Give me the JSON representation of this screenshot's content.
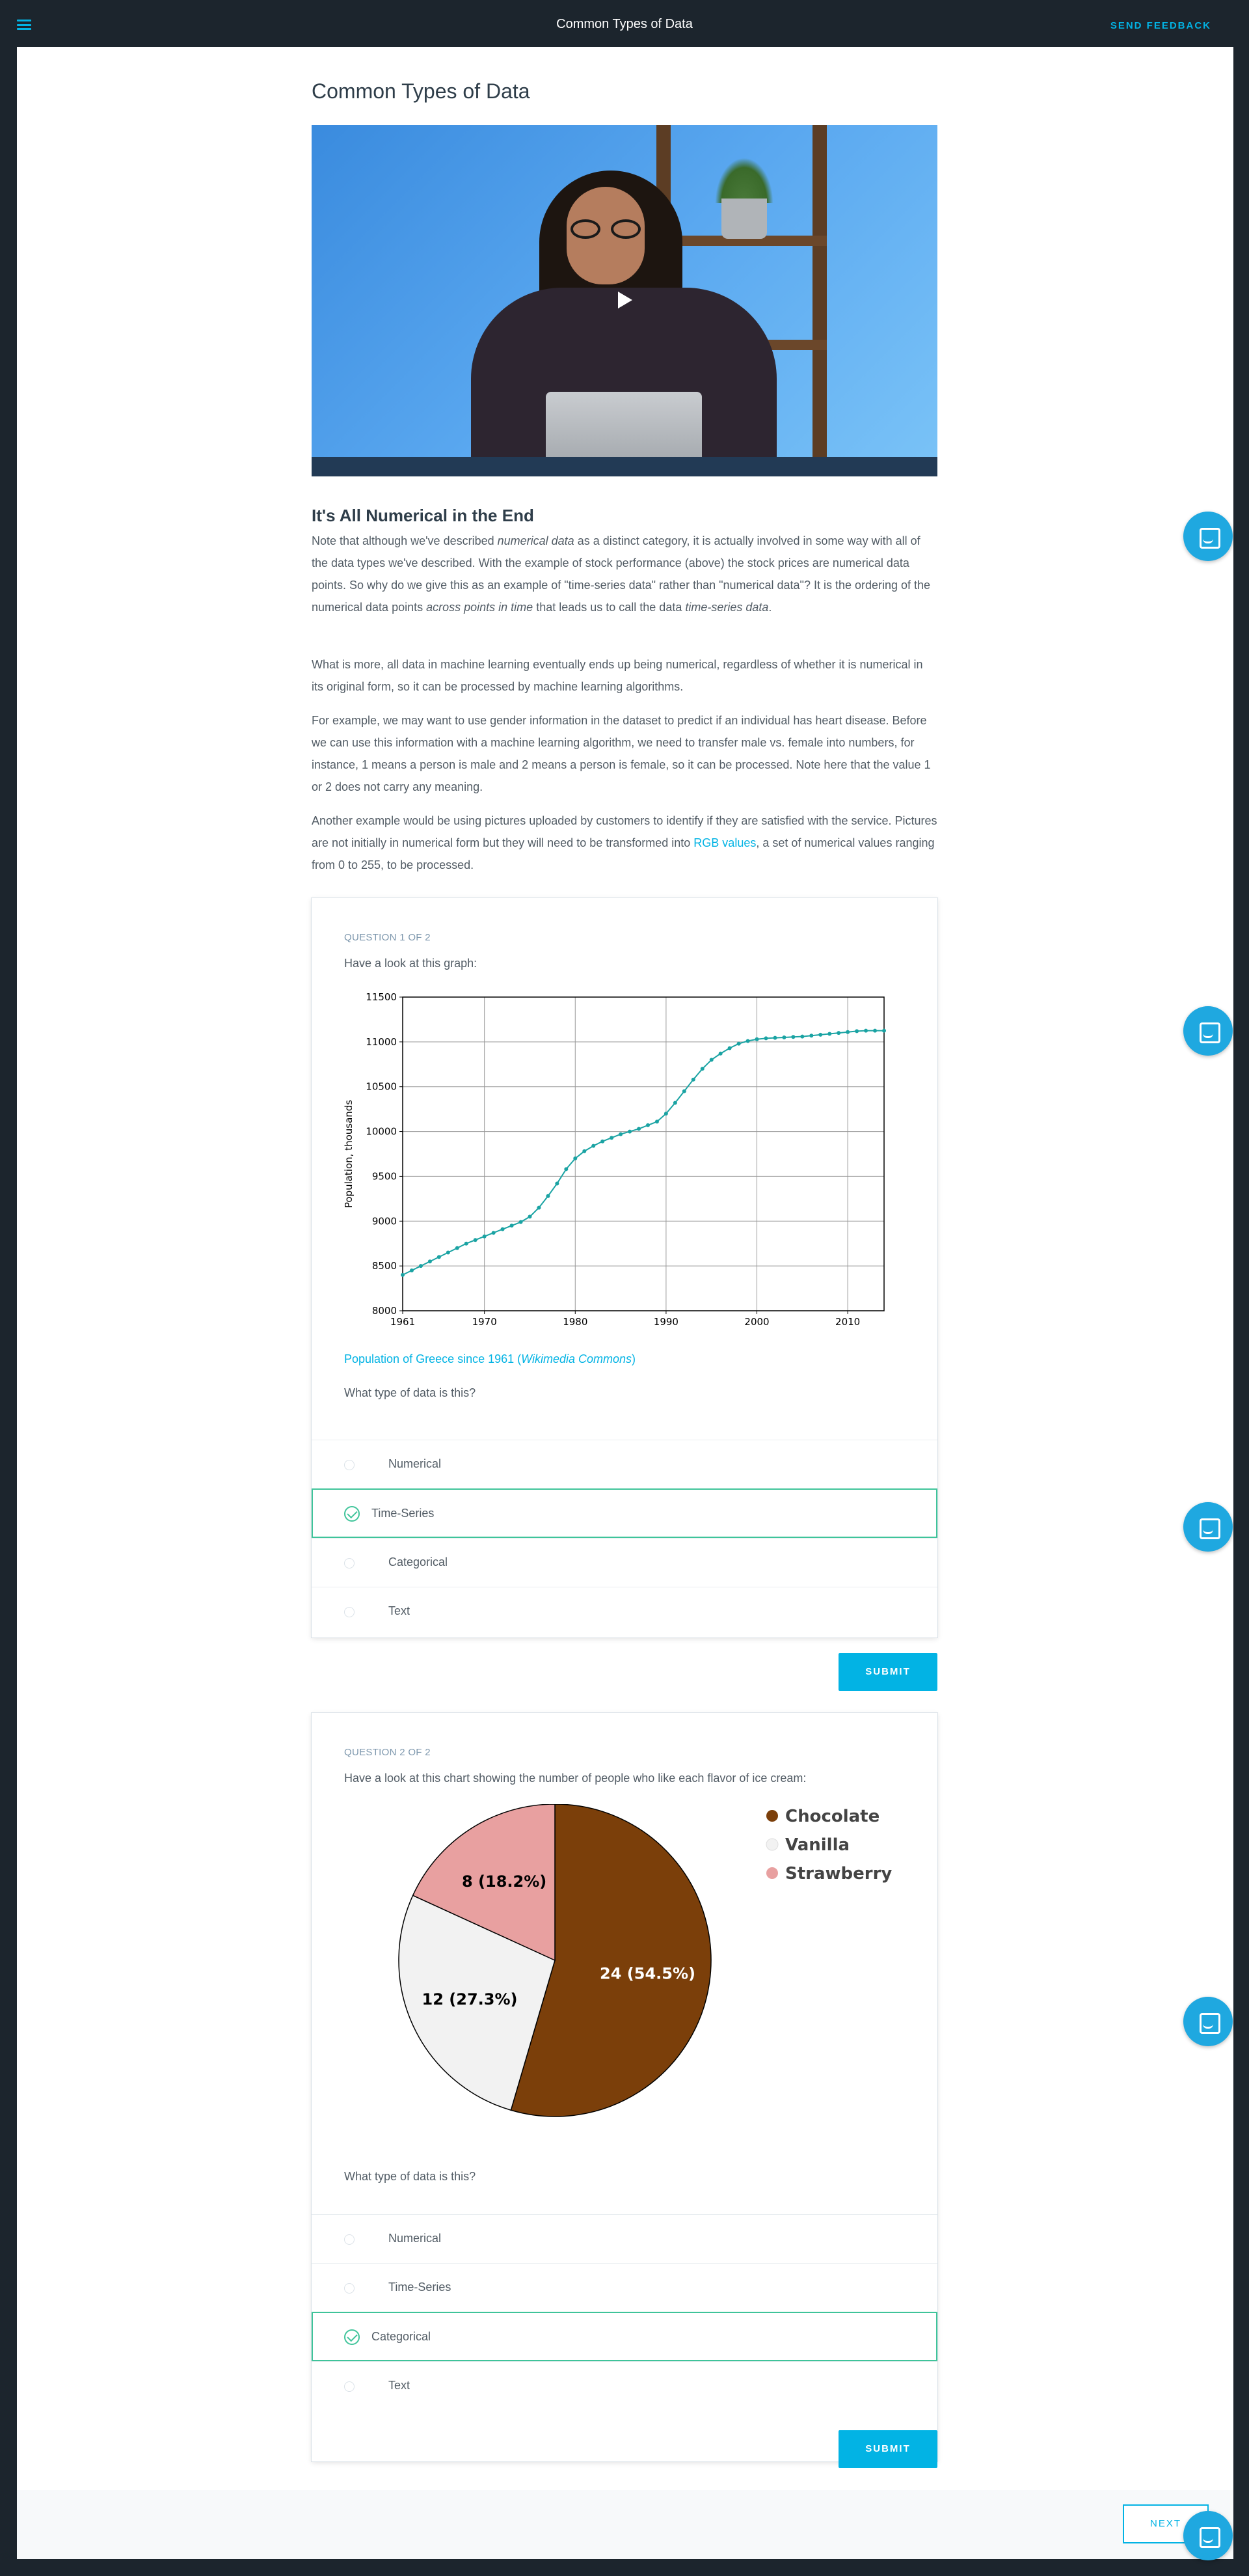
{
  "header": {
    "title": "Common Types of Data",
    "feedback_label": "SEND FEEDBACK"
  },
  "lesson": {
    "title": "Common Types of Data",
    "section_title": "It's All Numerical in the End",
    "p1": {
      "a": "Note that although we've described ",
      "b": "numerical data",
      "c": " as a distinct category, it is actually involved in some way with all of the data types we've described. With the example of stock performance (above) the stock prices are numerical data points. So why do we give this as an example of \"time-series data\" rather than \"numerical data\"? It is the ordering of the numerical data points ",
      "d": "across points in time",
      "e": " that leads us to call the data ",
      "f": "time-series data",
      "g": "."
    },
    "p2": "What is more, all data in machine learning eventually ends up being numerical, regardless of whether it is numerical in its original form, so it can be processed by machine learning algorithms.",
    "p3": "For example, we may want to use gender information in the dataset to predict if an individual has heart disease. Before we can use this information with a machine learning algorithm, we need to transfer male vs. female into numbers, for instance, 1 means a person is male and 2 means a person is female, so it can be processed. Note here that the value 1 or 2 does not carry any meaning.",
    "p4": {
      "a": "Another example would be using pictures uploaded by customers to identify if they are satisfied with the service. Pictures are not initially in numerical form but they will need to be transformed into ",
      "link": "RGB values",
      "b": ", a set of numerical values ranging from 0 to 255, to be processed."
    }
  },
  "q1": {
    "label": "QUESTION 1 OF 2",
    "prompt": "Have a look at this graph:",
    "caption": {
      "a": "Population of Greece since 1961 (",
      "b": "Wikimedia Commons",
      "c": ")"
    },
    "question": "What type of data is this?",
    "options": [
      "Numerical",
      "Time-Series",
      "Categorical",
      "Text"
    ],
    "selected": "Time-Series",
    "submit_label": "SUBMIT"
  },
  "q2": {
    "label": "QUESTION 2 OF 2",
    "prompt": "Have a look at this chart showing the number of people who like each flavor of ice cream:",
    "question": "What type of data is this?",
    "options": [
      "Numerical",
      "Time-Series",
      "Categorical",
      "Text"
    ],
    "selected": "Categorical",
    "submit_label": "SUBMIT"
  },
  "next_label": "NEXT",
  "chart_data": [
    {
      "type": "line",
      "ylabel": "Population, thousands",
      "xlim": [
        1961,
        2014
      ],
      "ylim": [
        8000,
        11500
      ],
      "x_ticks": [
        1961,
        1970,
        1980,
        1990,
        2000,
        2010
      ],
      "y_ticks": [
        8000,
        8500,
        9000,
        9500,
        10000,
        10500,
        11000,
        11500
      ],
      "grid": true,
      "color": "#1aa3a3",
      "x": [
        1961,
        1962,
        1963,
        1964,
        1965,
        1966,
        1967,
        1968,
        1969,
        1970,
        1971,
        1972,
        1973,
        1974,
        1975,
        1976,
        1977,
        1978,
        1979,
        1980,
        1981,
        1982,
        1983,
        1984,
        1985,
        1986,
        1987,
        1988,
        1989,
        1990,
        1991,
        1992,
        1993,
        1994,
        1995,
        1996,
        1997,
        1998,
        1999,
        2000,
        2001,
        2002,
        2003,
        2004,
        2005,
        2006,
        2007,
        2008,
        2009,
        2010,
        2011,
        2012,
        2013,
        2014
      ],
      "y": [
        8400,
        8450,
        8500,
        8550,
        8600,
        8650,
        8700,
        8750,
        8790,
        8830,
        8870,
        8910,
        8950,
        8990,
        9050,
        9150,
        9280,
        9420,
        9580,
        9700,
        9780,
        9840,
        9890,
        9930,
        9970,
        10000,
        10030,
        10070,
        10110,
        10200,
        10320,
        10450,
        10580,
        10700,
        10800,
        10870,
        10930,
        10980,
        11010,
        11030,
        11040,
        11045,
        11050,
        11055,
        11060,
        11070,
        11080,
        11090,
        11100,
        11110,
        11120,
        11125,
        11125,
        11125
      ]
    },
    {
      "type": "pie",
      "labels": [
        "Chocolate",
        "Vanilla",
        "Strawberry"
      ],
      "values": [
        24,
        12,
        8
      ],
      "data_labels": [
        "24 (54.5%)",
        "12 (27.3%)",
        "8 (18.2%)"
      ],
      "colors": [
        "#7b3f0a",
        "#f2f2f2",
        "#e8a0a0"
      ],
      "legend": "top-right"
    }
  ]
}
